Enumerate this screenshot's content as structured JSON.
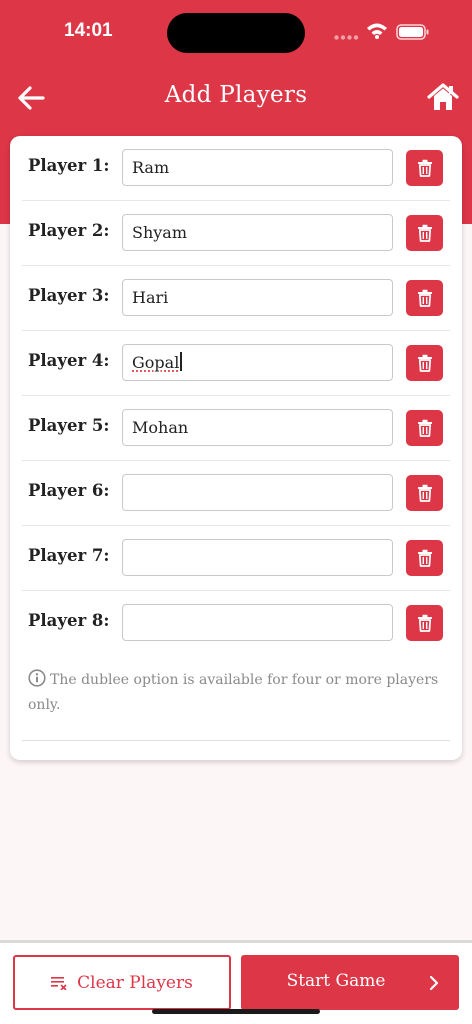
{
  "status_bar": {
    "time": "14:01"
  },
  "nav": {
    "title": "Add Players",
    "back_icon": "arrow-left-icon",
    "home_icon": "home-icon"
  },
  "players": [
    {
      "label": "Player 1:",
      "value": "Ram"
    },
    {
      "label": "Player 2:",
      "value": "Shyam"
    },
    {
      "label": "Player 3:",
      "value": "Hari"
    },
    {
      "label": "Player 4:",
      "value": "Gopal"
    },
    {
      "label": "Player 5:",
      "value": "Mohan"
    },
    {
      "label": "Player 6:",
      "value": ""
    },
    {
      "label": "Player 7:",
      "value": ""
    },
    {
      "label": "Player 8:",
      "value": ""
    }
  ],
  "info_note": "The dublee option is available for four or more players only.",
  "footer": {
    "clear_label": "Clear Players",
    "start_label": "Start Game"
  },
  "colors": {
    "accent": "#dd3647",
    "background": "#fdf6f6",
    "note_text": "#8a8a8a"
  }
}
